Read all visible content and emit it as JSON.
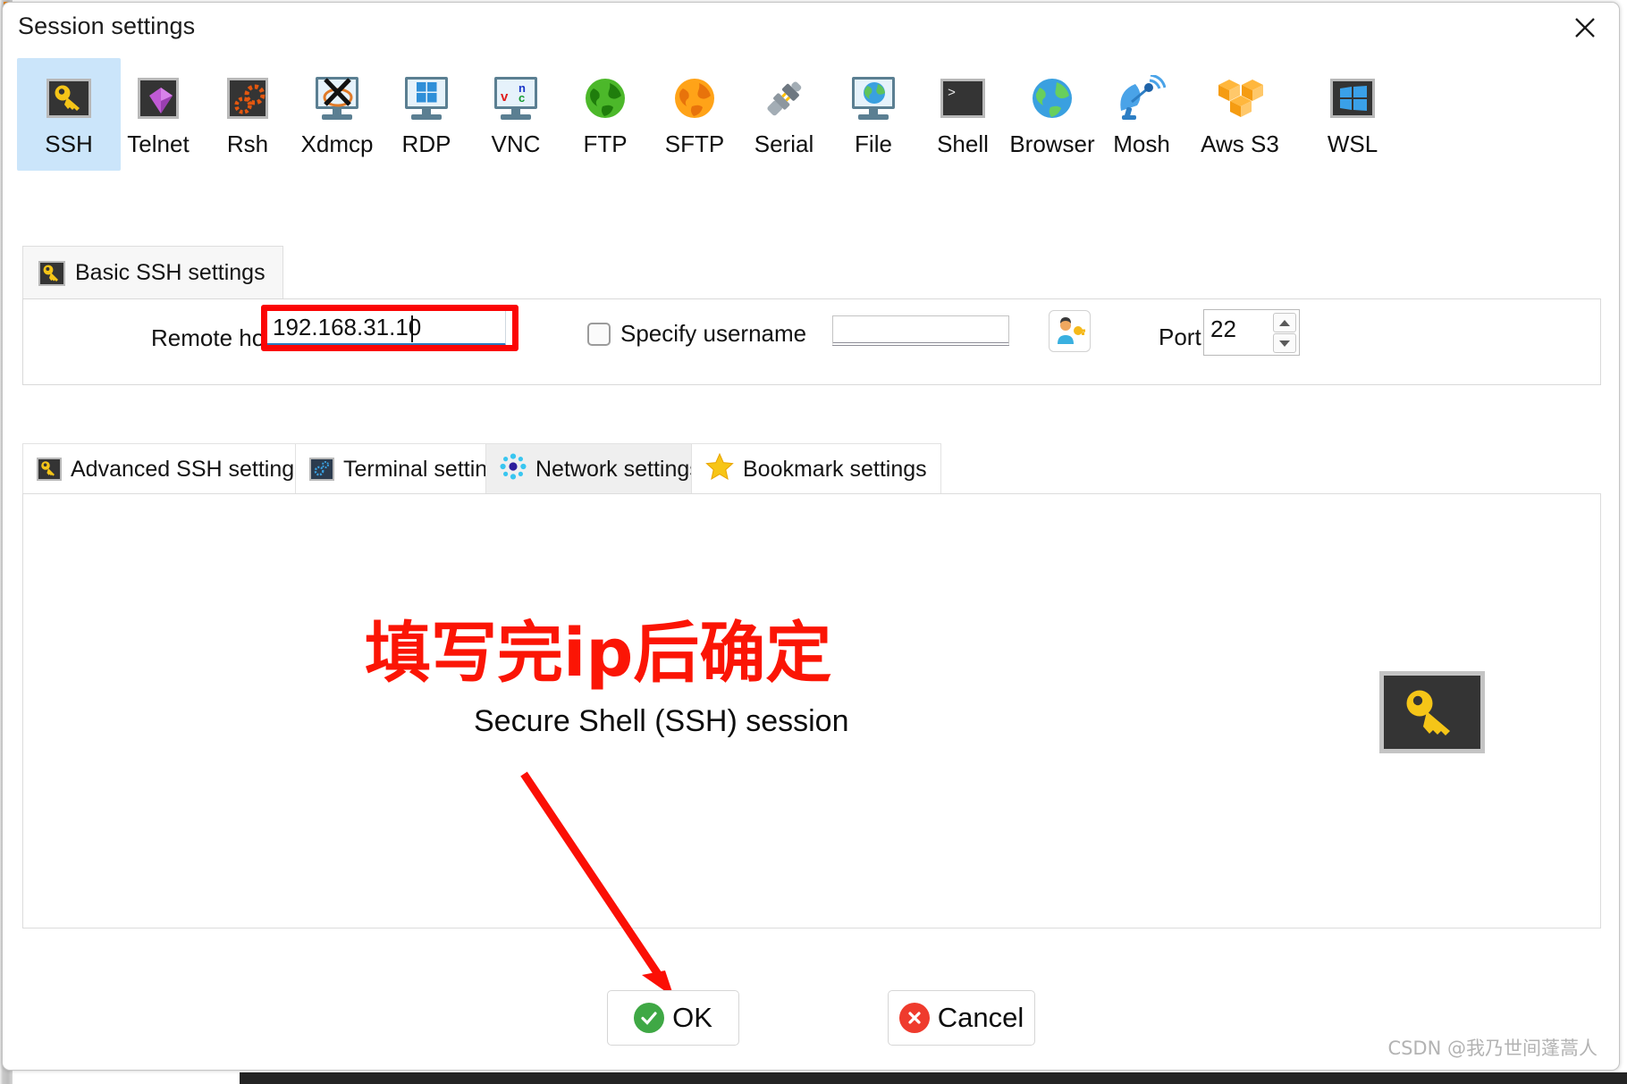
{
  "window": {
    "title": "Session settings",
    "close_icon": "close-icon"
  },
  "protocols": [
    {
      "label": "SSH",
      "icon": "key-icon",
      "selected": true
    },
    {
      "label": "Telnet",
      "icon": "gem-icon",
      "selected": false
    },
    {
      "label": "Rsh",
      "icon": "gears-icon",
      "selected": false
    },
    {
      "label": "Xdmcp",
      "icon": "x-monitor-icon",
      "selected": false
    },
    {
      "label": "RDP",
      "icon": "windows-monitor-icon",
      "selected": false
    },
    {
      "label": "VNC",
      "icon": "vnc-monitor-icon",
      "selected": false
    },
    {
      "label": "FTP",
      "icon": "green-globe-icon",
      "selected": false
    },
    {
      "label": "SFTP",
      "icon": "orange-globe-icon",
      "selected": false
    },
    {
      "label": "Serial",
      "icon": "plug-icon",
      "selected": false
    },
    {
      "label": "File",
      "icon": "globe-monitor-icon",
      "selected": false
    },
    {
      "label": "Shell",
      "icon": "terminal-icon",
      "selected": false
    },
    {
      "label": "Browser",
      "icon": "blue-globe-icon",
      "selected": false
    },
    {
      "label": "Mosh",
      "icon": "satellite-dish-icon",
      "selected": false
    },
    {
      "label": "Aws S3",
      "icon": "aws-cubes-icon",
      "selected": false
    },
    {
      "label": "WSL",
      "icon": "windows-tile-icon",
      "selected": false
    }
  ],
  "basic_tab": {
    "label": "Basic SSH settings",
    "icon": "key-icon"
  },
  "form": {
    "remote_host_label": "Remote host *",
    "remote_host_value": "192.168.31.10",
    "remote_host_placeholder": "",
    "specify_username_label": "Specify username",
    "specify_username_checked": false,
    "username_value": "",
    "username_placeholder": "",
    "user_key_button_icon": "user-key-icon",
    "port_label": "Port",
    "port_value": "22",
    "spinner_up_icon": "chevron-up-icon",
    "spinner_down_icon": "chevron-down-icon",
    "highlight_color": "#fb0505"
  },
  "settings_tabs": [
    {
      "label": "Advanced SSH settings",
      "icon": "key-icon",
      "active": false
    },
    {
      "label": "Terminal settings",
      "icon": "terminal-gear-icon",
      "active": false
    },
    {
      "label": "Network settings",
      "icon": "network-dots-icon",
      "active": true
    },
    {
      "label": "Bookmark settings",
      "icon": "star-icon",
      "active": false
    }
  ],
  "panel": {
    "annotation_cn": "填写完ip后确定",
    "annotation_color": "#fb1505",
    "session_description": "Secure Shell (SSH) session",
    "big_icon": "key-icon",
    "arrow_icon": "red-arrow-annotation"
  },
  "footer": {
    "ok_label": "OK",
    "ok_icon": "check-circle-icon",
    "cancel_label": "Cancel",
    "cancel_icon": "cross-circle-icon",
    "ok_color": "#3fa845",
    "cancel_color": "#ef3b2d"
  },
  "watermark": {
    "text": "CSDN @我乃世间蓬蒿人"
  }
}
